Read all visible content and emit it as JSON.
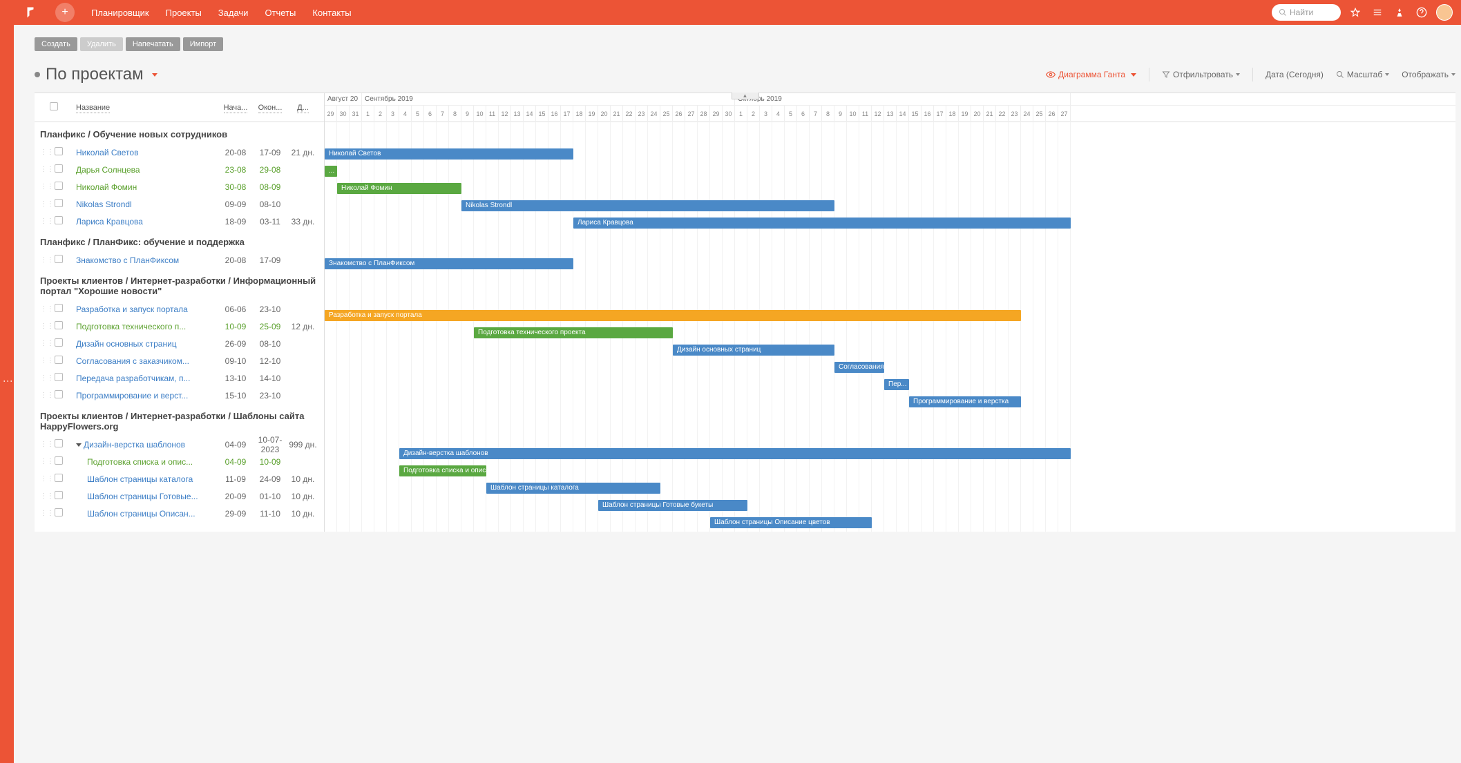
{
  "nav": {
    "items": [
      "Планировщик",
      "Проекты",
      "Задачи",
      "Отчеты",
      "Контакты"
    ],
    "search_placeholder": "Найти"
  },
  "actions": {
    "create": "Создать",
    "delete": "Удалить",
    "print": "Напечатать",
    "import": "Импорт"
  },
  "page_title": "По проектам",
  "view_bar": {
    "gantt": "Диаграмма Ганта",
    "filter": "Отфильтровать",
    "date": "Дата (Сегодня)",
    "scale": "Масштаб",
    "display": "Отображать"
  },
  "headers": {
    "name": "Название",
    "start": "Нача...",
    "end": "Окон...",
    "dur": "Д..."
  },
  "timeline": {
    "months": [
      {
        "label": "Август 20",
        "days": 3
      },
      {
        "label": "Сентябрь 2019",
        "days": 30
      },
      {
        "label": "Октябрь 2019",
        "days": 27
      }
    ],
    "days": [
      29,
      30,
      31,
      1,
      2,
      3,
      4,
      5,
      6,
      7,
      8,
      9,
      10,
      11,
      12,
      13,
      14,
      15,
      16,
      17,
      18,
      19,
      20,
      21,
      22,
      23,
      24,
      25,
      26,
      27,
      28,
      29,
      30,
      1,
      2,
      3,
      4,
      5,
      6,
      7,
      8,
      9,
      10,
      11,
      12,
      13,
      14,
      15,
      16,
      17,
      18,
      19,
      20,
      21,
      22,
      23,
      24,
      25,
      26,
      27
    ]
  },
  "groups": [
    {
      "title": "Планфикс / Обучение новых сотрудников",
      "tasks": [
        {
          "name": "Николай Светов",
          "start": "20-08",
          "end": "17-09",
          "dur": "21 дн.",
          "bar": {
            "from": 0,
            "to": 20,
            "color": "blue",
            "label": "Николай Светов"
          }
        },
        {
          "name": "Дарья Солнцева",
          "start": "23-08",
          "end": "29-08",
          "dur": "",
          "green": true,
          "bar": {
            "from": 0,
            "to": 1,
            "color": "green",
            "label": "..."
          }
        },
        {
          "name": "Николай Фомин",
          "start": "30-08",
          "end": "08-09",
          "dur": "",
          "green": true,
          "bar": {
            "from": 1,
            "to": 11,
            "color": "green",
            "label": "Николай Фомин"
          }
        },
        {
          "name": "Nikolas Strondl",
          "start": "09-09",
          "end": "08-10",
          "dur": "",
          "bar": {
            "from": 11,
            "to": 41,
            "color": "blue",
            "label": "Nikolas Strondl"
          }
        },
        {
          "name": "Лариса Кравцова",
          "start": "18-09",
          "end": "03-11",
          "dur": "33 дн.",
          "bar": {
            "from": 20,
            "to": 60,
            "color": "blue",
            "label": "Лариса Кравцова"
          }
        }
      ]
    },
    {
      "title": "Планфикс / ПланФикс: обучение и поддержка",
      "tasks": [
        {
          "name": "Знакомство с ПланФиксом",
          "start": "20-08",
          "end": "17-09",
          "dur": "",
          "bar": {
            "from": 0,
            "to": 20,
            "color": "blue",
            "label": "Знакомство с ПланФиксом"
          }
        }
      ]
    },
    {
      "title": "Проекты клиентов / Интернет-разработки / Информационный портал \"Хорошие новости\"",
      "tall": true,
      "tasks": [
        {
          "name": "Разработка и запуск портала",
          "start": "06-06",
          "end": "23-10",
          "dur": "",
          "bar": {
            "from": 0,
            "to": 56,
            "color": "orange",
            "label": "Разработка и запуск портала"
          }
        },
        {
          "name": "Подготовка технического п...",
          "start": "10-09",
          "end": "25-09",
          "dur": "12 дн.",
          "green": true,
          "bar": {
            "from": 12,
            "to": 28,
            "color": "green",
            "label": "Подготовка технического проекта"
          }
        },
        {
          "name": "Дизайн основных страниц",
          "start": "26-09",
          "end": "08-10",
          "dur": "",
          "bar": {
            "from": 28,
            "to": 41,
            "color": "blue",
            "label": "Дизайн основных страниц"
          }
        },
        {
          "name": "Согласования с заказчиком...",
          "start": "09-10",
          "end": "12-10",
          "dur": "",
          "bar": {
            "from": 41,
            "to": 45,
            "color": "blue",
            "label": "Согласования..."
          }
        },
        {
          "name": "Передача разработчикам, п...",
          "start": "13-10",
          "end": "14-10",
          "dur": "",
          "bar": {
            "from": 45,
            "to": 47,
            "color": "blue",
            "label": "Пер..."
          }
        },
        {
          "name": "Программирование и верст...",
          "start": "15-10",
          "end": "23-10",
          "dur": "",
          "bar": {
            "from": 47,
            "to": 56,
            "color": "blue",
            "label": "Программирование и верстка"
          }
        }
      ]
    },
    {
      "title": "Проекты клиентов / Интернет-разработки / Шаблоны сайта HappyFlowers.org",
      "tall": true,
      "tasks": [
        {
          "name": "Дизайн-верстка шаблонов",
          "start": "04-09",
          "end": "10-07-2023",
          "dur": "999 дн.",
          "expandable": true,
          "bar": {
            "from": 6,
            "to": 60,
            "color": "blue",
            "label": "Дизайн-верстка шаблонов"
          }
        },
        {
          "name": "Подготовка списка и опис...",
          "start": "04-09",
          "end": "10-09",
          "dur": "",
          "green": true,
          "indent": 1,
          "bar": {
            "from": 6,
            "to": 13,
            "color": "green",
            "label": "Подготовка списка и описа..."
          }
        },
        {
          "name": "Шаблон страницы каталога",
          "start": "11-09",
          "end": "24-09",
          "dur": "10 дн.",
          "indent": 1,
          "bar": {
            "from": 13,
            "to": 27,
            "color": "blue",
            "label": "Шаблон страницы каталога"
          }
        },
        {
          "name": "Шаблон страницы Готовые...",
          "start": "20-09",
          "end": "01-10",
          "dur": "10 дн.",
          "indent": 1,
          "bar": {
            "from": 22,
            "to": 34,
            "color": "blue",
            "label": "Шаблон страницы Готовые букеты"
          }
        },
        {
          "name": "Шаблон страницы Описан...",
          "start": "29-09",
          "end": "11-10",
          "dur": "10 дн.",
          "indent": 1,
          "bar": {
            "from": 31,
            "to": 44,
            "color": "blue",
            "label": "Шаблон страницы Описание цветов"
          }
        }
      ]
    }
  ]
}
